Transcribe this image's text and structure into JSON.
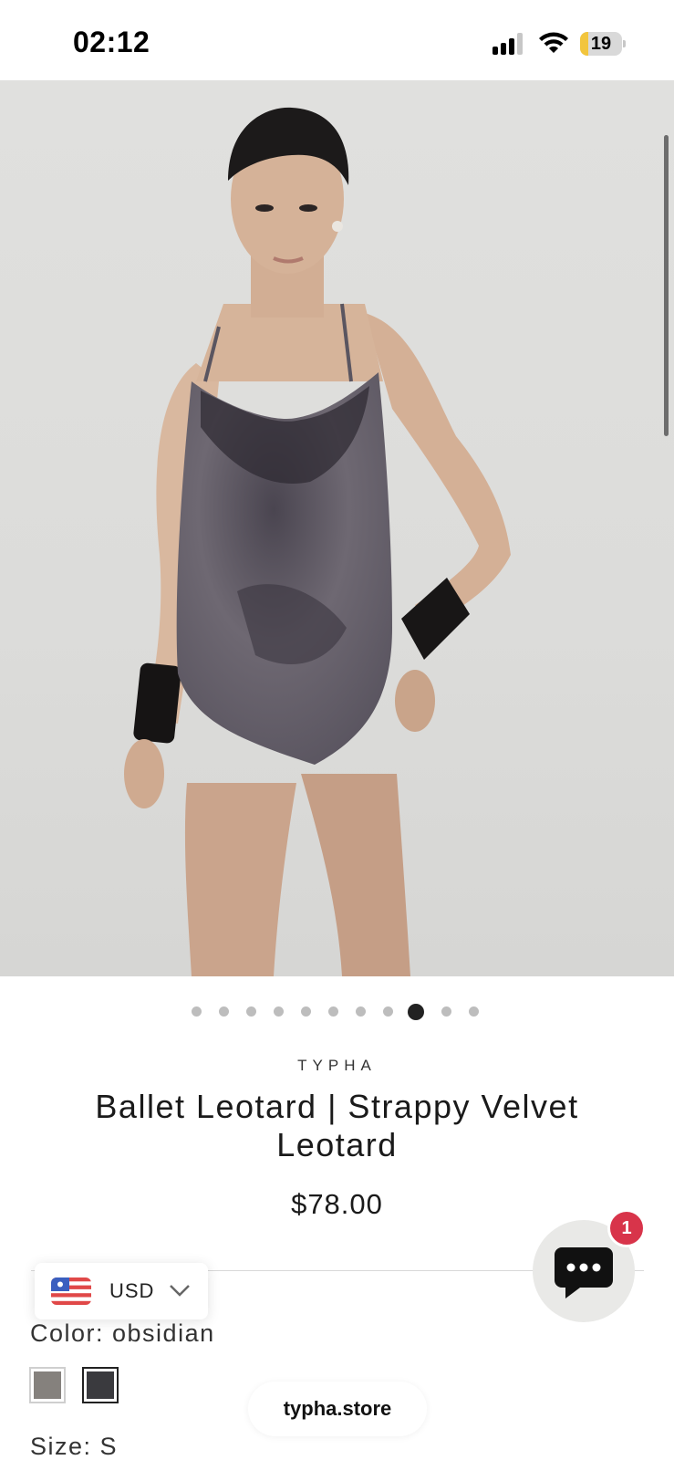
{
  "status_bar": {
    "time": "02:12",
    "battery_level": "19",
    "battery_fraction": 0.19,
    "battery_color": "#f2c53d"
  },
  "hero": {
    "image_subject": "model wearing velvet leotard",
    "carousel": {
      "total": 11,
      "active_index": 8
    }
  },
  "product": {
    "brand": "TYPHA",
    "title": "Ballet Leotard | Strappy Velvet Leotard",
    "price": "$78.00",
    "color_label": "Color: obsidian",
    "size_label": "Size: S",
    "swatches": [
      {
        "name": "taupe",
        "color": "#85817d",
        "selected": false
      },
      {
        "name": "obsidian",
        "color": "#3a3a3e",
        "selected": true
      }
    ]
  },
  "currency": {
    "code": "USD",
    "icon": "us-flag-icon"
  },
  "chat": {
    "badge_count": "1",
    "icon": "chat-bubble-icon"
  },
  "browser": {
    "url": "typha.store"
  }
}
